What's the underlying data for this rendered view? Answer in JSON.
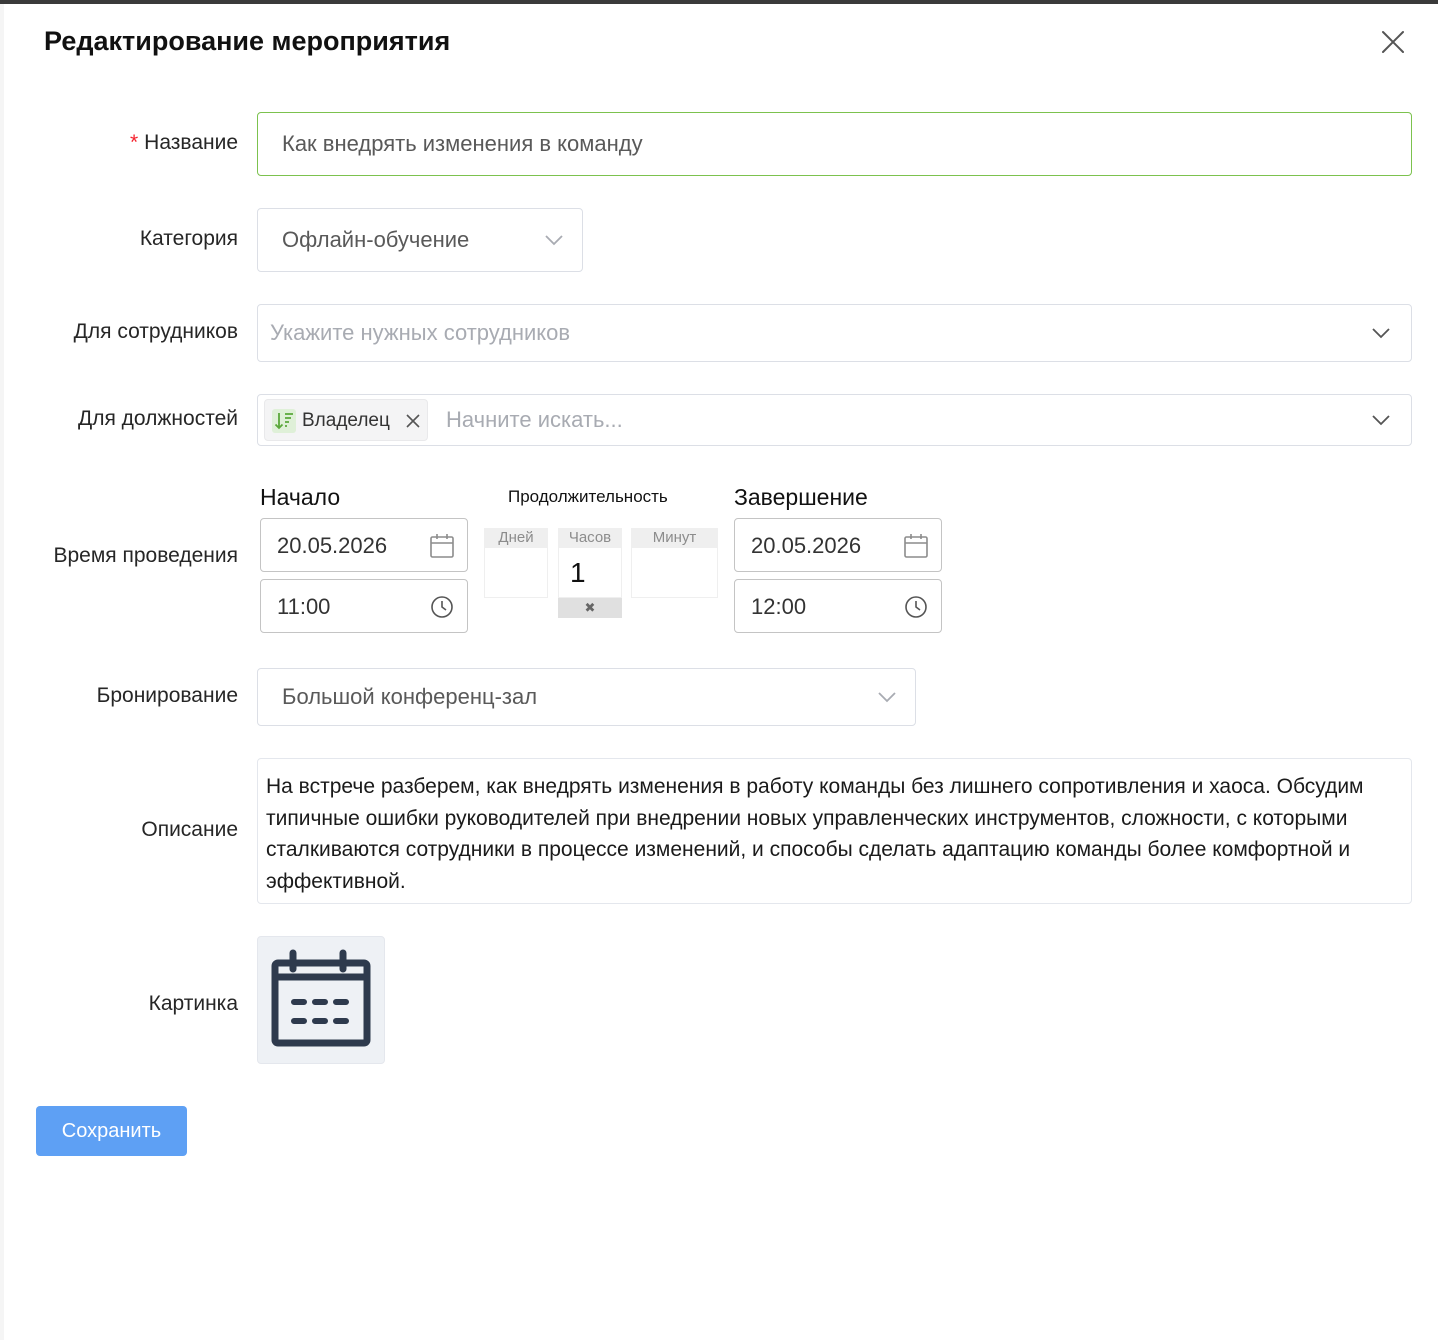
{
  "dialog": {
    "title": "Редактирование мероприятия"
  },
  "form": {
    "name": {
      "label": "Название",
      "required_mark": "*",
      "value": "Как внедрять изменения в команду"
    },
    "category": {
      "label": "Категория",
      "value": "Офлайн-обучение"
    },
    "employees": {
      "label": "Для сотрудников",
      "placeholder": "Укажите нужных сотрудников"
    },
    "positions": {
      "label": "Для должностей",
      "tags": [
        "Владелец"
      ],
      "placeholder": "Начните искать..."
    },
    "time": {
      "label": "Время проведения",
      "start": {
        "heading": "Начало",
        "date": "20.05.2026",
        "time": "11:00"
      },
      "duration": {
        "heading": "Продолжительность",
        "days": {
          "caption": "Дней",
          "value": ""
        },
        "hours": {
          "caption": "Часов",
          "value": "1",
          "clear": "✖"
        },
        "minutes": {
          "caption": "Минут",
          "value": ""
        }
      },
      "end": {
        "heading": "Завершение",
        "date": "20.05.2026",
        "time": "12:00"
      }
    },
    "booking": {
      "label": "Бронирование",
      "value": "Большой конференц-зал"
    },
    "description": {
      "label": "Описание",
      "value": "На встрече разберем, как внедрять изменения в работу команды без лишнего сопротивления и хаоса. Обсудим типичные ошибки руководителей при внедрении новых управленческих инструментов, сложности, с которыми сталкиваются сотрудники в процессе изменений, и способы сделать адаптацию команды более комфортной и эффективной."
    },
    "picture": {
      "label": "Картинка",
      "icon": "calendar-icon"
    }
  },
  "actions": {
    "save_label": "Сохранить"
  },
  "colors": {
    "accent": "#5ea0f4",
    "active_border": "#7cc24e",
    "required": "#f5222d",
    "icon_dark": "#2e3a4d"
  }
}
